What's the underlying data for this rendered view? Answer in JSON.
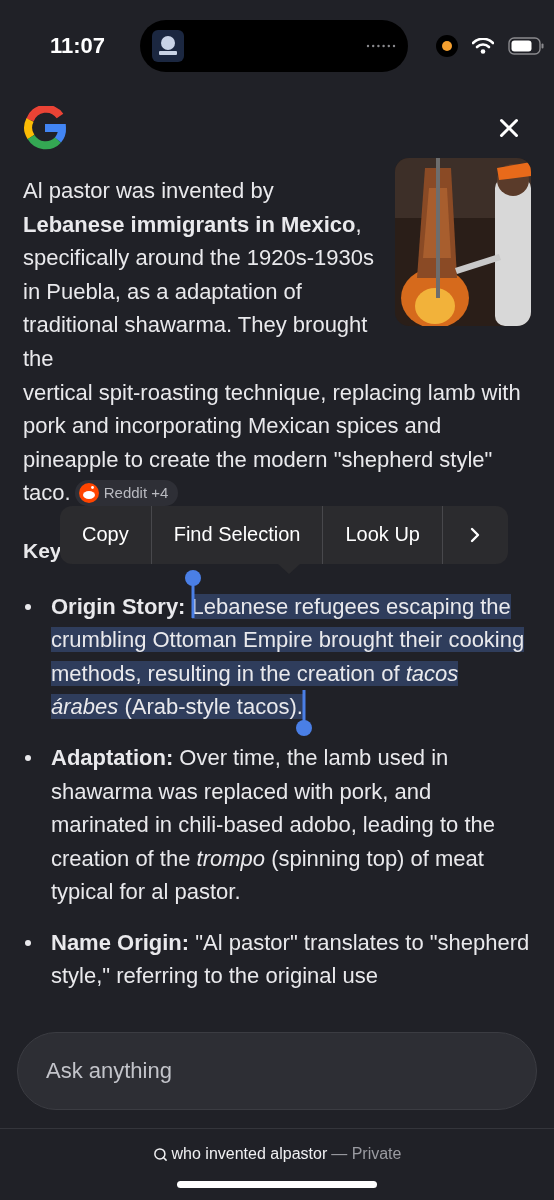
{
  "status_bar": {
    "time": "11:07"
  },
  "answer": {
    "paragraph_segments": [
      "Al pastor was invented by **Lebanese immigrants in Mexico**, specifically around the 1920s-1930s in Puebla, as a adaptation of traditional shawarma. They brought the",
      "vertical spit-roasting technique, replacing lamb with pork and incorporating Mexican spices and pineapple to create the modern \"shepherd style\"",
      "taco."
    ],
    "source_chip": "Reddit +4"
  },
  "heading": "Key",
  "context_menu": {
    "items": [
      "Copy",
      "Find Selection",
      "Look Up"
    ]
  },
  "bullets": [
    {
      "label": "Origin Story:",
      "text": "Lebanese refugees escaping the crumbling Ottoman Empire brought their cooking methods, resulting in the creation of *tacos árabes* (Arab-style tacos).",
      "selected": true
    },
    {
      "label": "Adaptation:",
      "text": "Over time, the lamb used in shawarma was replaced with pork, and marinated in chili-based adobo, leading to the creation of the *trompo* (spinning top) of meat typical for al pastor.",
      "selected": false
    },
    {
      "label": "Name Origin:",
      "text": "\"Al pastor\" translates to \"shepherd style,\" referring to the original use",
      "selected": false
    }
  ],
  "input": {
    "placeholder": "Ask anything"
  },
  "footer": {
    "query": "who invented alpastor",
    "suffix": "— Private"
  }
}
